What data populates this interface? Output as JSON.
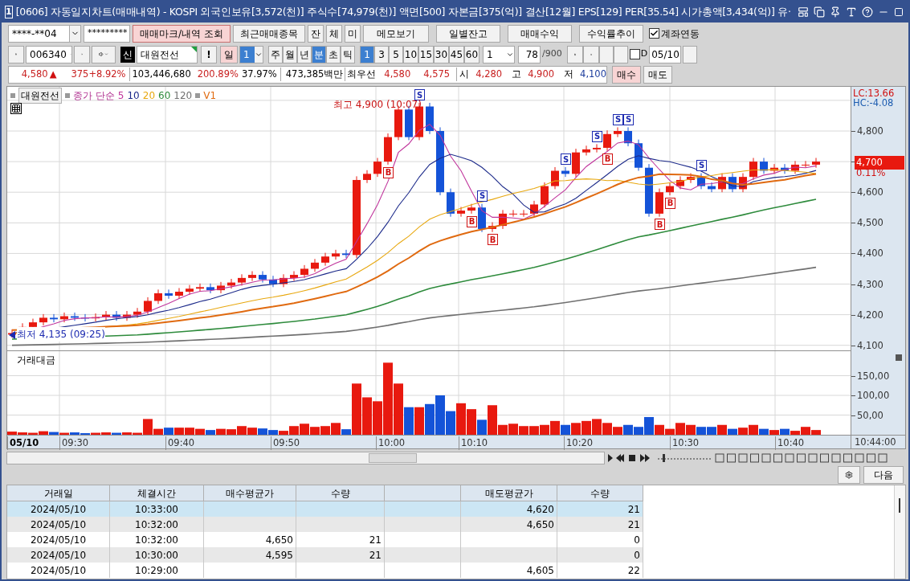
{
  "window": {
    "number": "1",
    "title": "[0606] 자동일지차트(매매내역) - KOSPI 외국인보유[3,572(천)] 주식수[74,979(천)] 액면[500] 자본금[375(억)] 결산[12월] EPS[129] PER[35.54] 시가총액[3,434(억)] 유·"
  },
  "toolbar1": {
    "account": "****-**04",
    "password": "*********",
    "buttons": [
      {
        "label": "매매마크/내역 조회",
        "kind": "active"
      },
      {
        "label": "최근매매종목",
        "kind": "normal"
      },
      {
        "label": "잔",
        "kind": "normal"
      },
      {
        "label": "체",
        "kind": "normal"
      },
      {
        "label": "미",
        "kind": "normal"
      },
      {
        "label": "메모보기",
        "kind": "normal"
      },
      {
        "label": "일별잔고",
        "kind": "wide"
      },
      {
        "label": "매매수익",
        "kind": "wide"
      },
      {
        "label": "수익률추이",
        "kind": "wide"
      }
    ],
    "link_checkbox": {
      "label": "계좌연동",
      "checked": true
    }
  },
  "toolbar2": {
    "code": "006340",
    "name_badge": "신",
    "name": "대원전선",
    "alert": "!",
    "day_label": "일",
    "day_value": "1",
    "period_tabs": [
      {
        "label": "주",
        "selected": false
      },
      {
        "label": "월",
        "selected": false
      },
      {
        "label": "년",
        "selected": false
      },
      {
        "label": "분",
        "selected": true
      },
      {
        "label": "초",
        "selected": false
      },
      {
        "label": "틱",
        "selected": false
      }
    ],
    "interval_tabs": [
      {
        "label": "1",
        "selected": true
      },
      {
        "label": "3",
        "selected": false
      },
      {
        "label": "5",
        "selected": false
      },
      {
        "label": "10",
        "selected": false
      },
      {
        "label": "15",
        "selected": false
      },
      {
        "label": "30",
        "selected": false
      },
      {
        "label": "45",
        "selected": false
      },
      {
        "label": "60",
        "selected": false
      }
    ],
    "interval_value": "1",
    "count": "78",
    "count_max": "/900",
    "d_checkbox": {
      "label": "D",
      "checked": false
    },
    "date": "05/10"
  },
  "quote": {
    "price": "4,580",
    "arrow": "▲",
    "change": "375",
    "change_pct": "+8.92%",
    "volume": "103,446,680",
    "volume_ratio": "200.89%",
    "turnover": "37.97%",
    "amount": "473,385백만",
    "best_label": "최우선",
    "best_ask": "4,580",
    "best_bid": "4,575",
    "open_label": "시",
    "open": "4,280",
    "high_label": "고",
    "high": "4,900",
    "low_label": "저",
    "low": "4,100",
    "buy_button": "매수",
    "sell_button": "매도"
  },
  "chart": {
    "legend": {
      "name": "대원전선",
      "ma_label": "종가 단순",
      "periods": [
        {
          "label": "5",
          "color": "#c0359c"
        },
        {
          "label": "10",
          "color": "#1c2a8a"
        },
        {
          "label": "20",
          "color": "#e8a810"
        },
        {
          "label": "60",
          "color": "#2e8b3c"
        },
        {
          "label": "120",
          "color": "#707070"
        }
      ],
      "extra": {
        "label": "V1",
        "color": "#e06a10"
      }
    },
    "high_note": "최고 4,900 (10:07)",
    "low_note": "최저 4,135 (09:25)",
    "lc": "LC:13.66",
    "hc": "HC:-4.08",
    "current_price": "4,700",
    "current_pct": "0.11%",
    "y_labels": [
      "4,800",
      "4,600",
      "4,500",
      "4,400",
      "4,300",
      "4,200",
      "4,100"
    ],
    "trade_marks": [
      {
        "label": "B",
        "kind": "buy"
      },
      {
        "label": "S",
        "kind": "sell"
      },
      {
        "label": "B",
        "kind": "buy"
      },
      {
        "label": "S",
        "kind": "sell"
      },
      {
        "label": "B",
        "kind": "buy"
      },
      {
        "label": "S",
        "kind": "sell"
      },
      {
        "label": "S",
        "kind": "sell"
      },
      {
        "label": "B",
        "kind": "buy"
      },
      {
        "label": "S",
        "kind": "sell"
      },
      {
        "label": "S",
        "kind": "sell"
      },
      {
        "label": "B",
        "kind": "buy"
      },
      {
        "label": "B",
        "kind": "buy"
      },
      {
        "label": "S",
        "kind": "sell"
      }
    ],
    "volume_title": "거래대금",
    "volume_labels": [
      "150,00",
      "100,00",
      "50,00"
    ],
    "time_labels": [
      "05/10",
      "09:30",
      "09:40",
      "09:50",
      "10:00",
      "10:10",
      "10:20",
      "10:30",
      "10:40"
    ],
    "end_time": "10:44:00"
  },
  "footer": {
    "next_button": "다음"
  },
  "table": {
    "columns": [
      {
        "kind": "text",
        "label": "거래일"
      },
      {
        "kind": "text",
        "label": "체결시간"
      },
      {
        "kind": "text",
        "label": "매수평균가"
      },
      {
        "kind": "text",
        "label": "수량"
      },
      {
        "kind": "blank"
      },
      {
        "kind": "text",
        "label": "매도평균가"
      },
      {
        "kind": "text",
        "label": "수량"
      }
    ],
    "rows": [
      {
        "selected": true,
        "date": "2024/05/10",
        "time": "10:33:00",
        "sell_avg": "4,620",
        "sell_qty": "21"
      },
      {
        "selected": false,
        "date": "2024/05/10",
        "time": "10:32:00",
        "sell_avg": "4,650",
        "sell_qty": "21"
      },
      {
        "selected": false,
        "date": "2024/05/10",
        "time": "10:32:00",
        "buy_avg": "4,650",
        "buy_qty": "21",
        "sell_qty": "0"
      },
      {
        "selected": false,
        "date": "2024/05/10",
        "time": "10:30:00",
        "buy_avg": "4,595",
        "buy_qty": "21",
        "sell_qty": "0"
      },
      {
        "selected": false,
        "date": "2024/05/10",
        "time": "10:29:00",
        "sell_avg": "4,605",
        "sell_qty": "22"
      }
    ]
  }
}
